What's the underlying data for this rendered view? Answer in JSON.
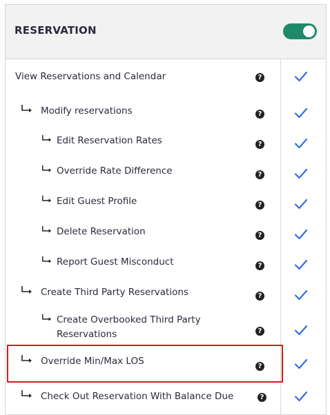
{
  "header": {
    "title": "RESERVATION",
    "toggle_on": true,
    "toggle_color": "#1f8a68"
  },
  "permissions": [
    {
      "label": "View Reservations and Calendar",
      "level": 0,
      "checked": true,
      "help_icon": "question-circle-icon"
    },
    {
      "label": "Modify reservations",
      "level": 1,
      "checked": true,
      "help_icon": "question-circle-icon"
    },
    {
      "label": "Edit Reservation Rates",
      "level": 2,
      "checked": true,
      "help_icon": "question-circle-icon"
    },
    {
      "label": "Override Rate Difference",
      "level": 2,
      "checked": true,
      "help_icon": "question-circle-icon"
    },
    {
      "label": "Edit Guest Profile",
      "level": 2,
      "checked": true,
      "help_icon": "question-circle-icon"
    },
    {
      "label": "Delete Reservation",
      "level": 2,
      "checked": true,
      "help_icon": "question-circle-icon"
    },
    {
      "label": "Report Guest Misconduct",
      "level": 2,
      "checked": true,
      "help_icon": "question-circle-icon"
    },
    {
      "label": "Create Third Party Reservations",
      "level": 1,
      "checked": true,
      "help_icon": "question-circle-icon"
    },
    {
      "label_line1": "Create Overbooked Third Party",
      "label_line2": "Reservations",
      "level": 2,
      "checked": true,
      "help_icon": "question-circle-icon"
    },
    {
      "label": "Override Min/Max LOS",
      "level": 1,
      "checked": true,
      "highlighted": true,
      "help_icon": "question-circle-icon"
    },
    {
      "label": "Check Out Reservation With Balance Due",
      "level": 1,
      "checked": true,
      "help_icon": "question-circle-icon"
    }
  ],
  "help_glyph": "?",
  "colors": {
    "check": "#2f6fe0",
    "highlight_border": "#e0141b"
  }
}
